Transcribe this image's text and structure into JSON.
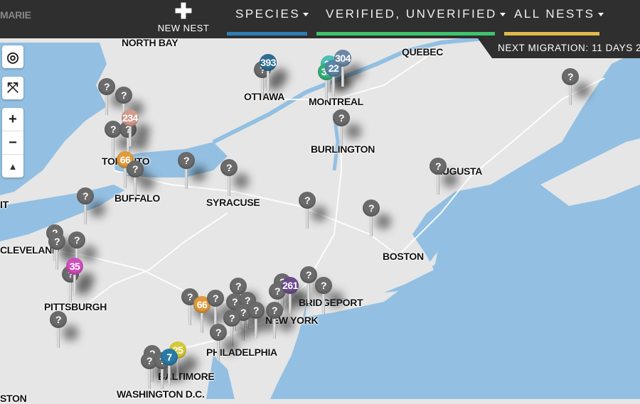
{
  "topbar": {
    "new_nest_icon": "plus-icon",
    "new_nest_label": "NEW NEST",
    "filters": [
      {
        "label": "SPECIES",
        "underline_color": "#2e7fb8"
      },
      {
        "label": "VERIFIED, UNVERIFIED",
        "underline_color": "#3ec46d"
      },
      {
        "label": "ALL NESTS",
        "underline_color": "#e2b94a"
      }
    ],
    "migration": "NEXT MIGRATION: 11 DAYS 2"
  },
  "map_controls": {
    "locate_icon": "crosshair-icon",
    "fullscreen_icon": "expand-arrows-icon",
    "zoom_in": "+",
    "zoom_out": "−",
    "compass_icon": "north-arrow-icon"
  },
  "cities": [
    "MARIE",
    "NORTH BAY",
    "OTTAWA",
    "MONTREAL",
    "QUEBEC",
    "BURLINGTON",
    "TORONTO",
    "BUFFALO",
    "SYRACUSE",
    "AUGUSTA",
    "BOSTON",
    "CLEVELAND",
    "PITTSBURGH",
    "BRIDGEPORT",
    "NEW YORK",
    "PHILADELPHIA",
    "BALTIMORE",
    "WASHINGTON D.C.",
    "STON",
    "IT"
  ],
  "colors": {
    "water": "#93c0e2",
    "land": "#e6e6e6",
    "unknown_pin": "#6b6b6b"
  },
  "markers": [
    {
      "label": "393",
      "color": "#2f6e94"
    },
    {
      "label": "304",
      "color": "#6b88a6"
    },
    {
      "label": "22",
      "color": "#5a86a8"
    },
    {
      "label": "38",
      "color": "#35b07a"
    },
    {
      "label": "26",
      "color": "#4cbfb6"
    },
    {
      "label": "234",
      "color": "#d29b8e"
    },
    {
      "label": "66",
      "color": "#e29a3a"
    },
    {
      "label": "35",
      "color": "#d24cbc"
    },
    {
      "label": "261",
      "color": "#6a4c8e"
    },
    {
      "label": "66",
      "color": "#e29a3a"
    },
    {
      "label": "25",
      "color": "#d6c936"
    },
    {
      "label": "7",
      "color": "#2a7aa6"
    },
    {
      "label": "?",
      "color": "#6b6b6b"
    }
  ]
}
